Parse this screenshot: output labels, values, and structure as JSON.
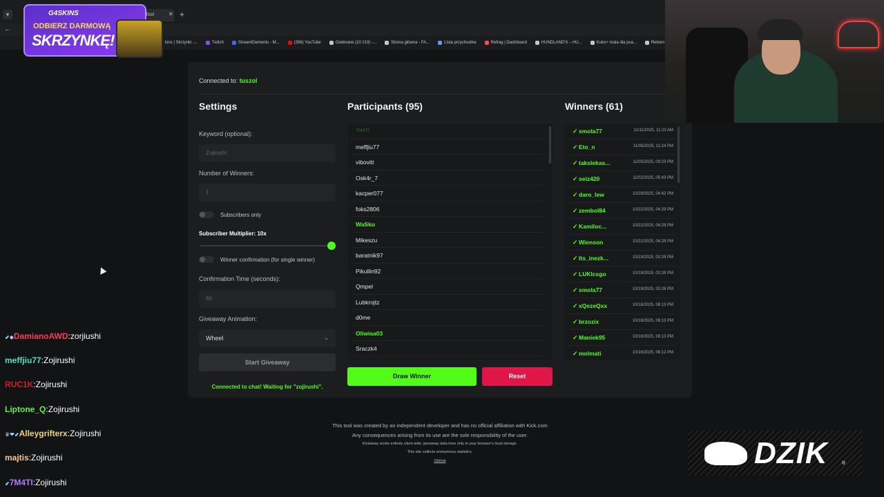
{
  "browser": {
    "tab_title": "way Tool",
    "bookmarks": [
      {
        "label": "kins | Skrzynki -...",
        "color": "#555555"
      },
      {
        "label": "Twitch",
        "color": "#9146ff"
      },
      {
        "label": "StreamElements - M...",
        "color": "#3b6cff"
      },
      {
        "label": "(356) YouTube",
        "color": "#ff0000"
      },
      {
        "label": "Odebrane (10 219) -...",
        "color": "#c7c7c7"
      },
      {
        "label": "Strona główna - FA...",
        "color": "#c7c7c7"
      },
      {
        "label": "Lista przychodów",
        "color": "#4fa3ff"
      },
      {
        "label": "Refrag | Dashboard",
        "color": "#ff4b4b"
      },
      {
        "label": "HUNDLAND'S – HU...",
        "color": "#c7c7c7"
      },
      {
        "label": "Kuko+ mata dla psa...",
        "color": "#c7c7c7"
      },
      {
        "label": "Reborn • The Ho...",
        "color": "#c7c7c7"
      }
    ]
  },
  "promo": {
    "logo": "G4SKINS",
    "line1": "ODBIERZ DARMOWĄ",
    "line2": "SKRZYNKĘ!"
  },
  "app": {
    "connected_label": "Connected to:",
    "connected_channel": "tuszol",
    "settings": {
      "title": "Settings",
      "keyword_label": "Keyword (optional):",
      "keyword_value": "Zojirushi",
      "winners_label": "Number of Winners:",
      "winners_value": "1",
      "subscribers_only": "Subscribers only",
      "multiplier_label": "Subscriber Multiplier: 10x",
      "multiplier_level": 1.0,
      "winner_confirmation": "Winner confirmation (for single winner)",
      "confirm_time_label": "Confirmation Time (seconds):",
      "confirm_time_value": "60",
      "animation_label": "Giveaway Animation:",
      "animation_value": "Wheel",
      "start_button": "Start Giveaway",
      "status": "Connected to chat! Waiting for \"zojirushi\"."
    },
    "participants": {
      "title": "Participants (95)",
      "items": [
        {
          "name": "7M4TI",
          "style": "faded"
        },
        {
          "name": "meffjiu77",
          "style": "normal"
        },
        {
          "name": "vibovitt",
          "style": "normal"
        },
        {
          "name": "Osk4r_7",
          "style": "normal"
        },
        {
          "name": "kacper077",
          "style": "normal"
        },
        {
          "name": "foks2806",
          "style": "normal"
        },
        {
          "name": "WaSku",
          "style": "green"
        },
        {
          "name": "Mikeszu",
          "style": "normal"
        },
        {
          "name": "baratnik97",
          "style": "normal"
        },
        {
          "name": "Pikullin92",
          "style": "normal"
        },
        {
          "name": "Qmpel",
          "style": "normal"
        },
        {
          "name": "Lubkrojtz",
          "style": "normal"
        },
        {
          "name": "d0me",
          "style": "normal"
        },
        {
          "name": "Oliwiaa03",
          "style": "green"
        },
        {
          "name": "Sraczk4",
          "style": "normal"
        }
      ]
    },
    "winners": {
      "title": "Winners (61)",
      "items": [
        {
          "name": "smola77",
          "date": "11/11/2025, 11:23 AM"
        },
        {
          "name": "Eto_n",
          "date": "11/05/2025, 11:24 PM"
        },
        {
          "name": "takslekas...",
          "date": "11/05/2025, 09:23 PM"
        },
        {
          "name": "seiz420",
          "date": "11/02/2025, 05:43 PM"
        },
        {
          "name": "daro_lew",
          "date": "10/29/2025, 04:42 PM"
        },
        {
          "name": "zembol84",
          "date": "10/22/2025, 04:29 PM"
        },
        {
          "name": "Kamiloc...",
          "date": "10/22/2025, 04:29 PM"
        },
        {
          "name": "Wienson",
          "date": "10/22/2025, 04:28 PM"
        },
        {
          "name": "Its_inezk...",
          "date": "10/19/2025, 02:29 PM"
        },
        {
          "name": "LUKIcsgo",
          "date": "10/19/2025, 02:28 PM"
        },
        {
          "name": "smola77",
          "date": "10/19/2025, 02:28 PM"
        },
        {
          "name": "xQezeQxx",
          "date": "10/16/2025, 08:13 PM"
        },
        {
          "name": "brzozix",
          "date": "10/16/2025, 08:13 PM"
        },
        {
          "name": "Maniek95",
          "date": "10/16/2025, 08:13 PM"
        },
        {
          "name": "molmati",
          "date": "10/16/2025, 08:12 PM"
        }
      ]
    },
    "draw_button": "Draw Winner",
    "reset_button": "Reset",
    "footer": {
      "line1": "This tool was created by an independent developer and has no official affiliation with Kick.com",
      "line2": "Any consequences arising from its use are the sole responsibility of the user.",
      "line3": "Kickaway works entirely client-side; giveaway data lives only in your browser's local storage.",
      "line4": "This site collects anonymous statistics.",
      "link": "GitHub"
    }
  },
  "chat": [
    {
      "user": "DamianoAWD",
      "msg": "zorjiushi",
      "color": "#ff3b5c",
      "badges": "⬋◆"
    },
    {
      "user": "meffjiu77",
      "msg": "Zojirushi",
      "color": "#4fe0c0",
      "badges": ""
    },
    {
      "user": "RUC1K",
      "msg": "Zojirushi",
      "color": "#d11f2a",
      "badges": ""
    },
    {
      "user": "Liptone_Q",
      "msg": "Zojirushi",
      "color": "#62f04a",
      "badges": ""
    },
    {
      "user": "Alleygrifterx",
      "msg": "Zojirushi",
      "color": "#f4d27a",
      "badges": "♛❤⬋"
    },
    {
      "user": "majtis",
      "msg": "Zojirushi",
      "color": "#f7c9a0",
      "badges": ""
    },
    {
      "user": "7M4TI",
      "msg": "Zojirushi",
      "color": "#b07cff",
      "badges": "⬋"
    }
  ],
  "overlay_logo": "DZIK",
  "colors": {
    "accent": "#53fc18",
    "danger": "#e01648",
    "card": "#1c1d1f"
  }
}
